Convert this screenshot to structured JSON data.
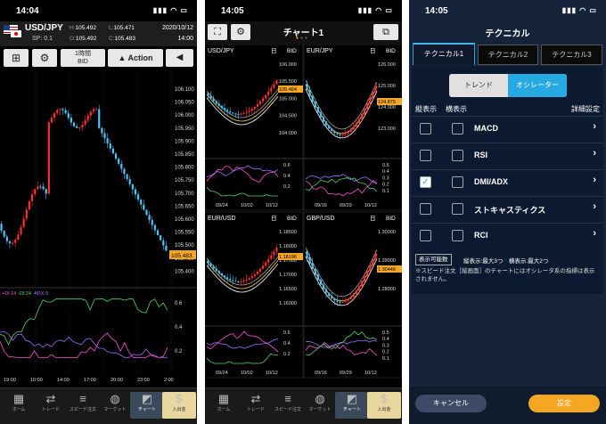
{
  "screen1": {
    "status_time": "14:04",
    "pair": "USD/JPY",
    "spread": "SP: 0.1",
    "high_label": "H:",
    "high_value": "105.492",
    "low_label": "L:",
    "low_value": "105.471",
    "open_label": "O:",
    "open_value": "105.492",
    "close_label": "C:",
    "close_value": "105.483",
    "date": "2020/10/12",
    "time": "14:00",
    "period_line1": "1時間",
    "period_line2": "BID",
    "action_label": "Action",
    "price_labels": [
      "106.100",
      "106.050",
      "106.000",
      "105.950",
      "105.900",
      "105.850",
      "105.800",
      "105.750",
      "105.700",
      "105.650",
      "105.600",
      "105.550",
      "105.500",
      "105.450",
      "105.400"
    ],
    "current_price": "105.483",
    "dmi_legend": {
      "di_plus": "+DI:14",
      "di_minus": "-DI:24",
      "adx": "ADX:9"
    },
    "osc_labels": [
      "0.6",
      "0.4",
      "0.2"
    ],
    "time_labels": [
      "19:00",
      "10:00",
      "14:00",
      "17:00",
      "20:00",
      "23:00",
      "2:00"
    ]
  },
  "screen2": {
    "status_time": "14:05",
    "title": "チャート1",
    "panes": [
      {
        "pair": "USD/JPY",
        "period": "日",
        "type": "BID",
        "prices": [
          "106.000",
          "105.500",
          "105.000",
          "104.500",
          "104.000"
        ],
        "current": "105.484",
        "osc": [
          "0.6",
          "0.4",
          "0.2"
        ],
        "dates": [
          "09/24",
          "10/02",
          "10/12"
        ]
      },
      {
        "pair": "EUR/JPY",
        "period": "日",
        "type": "BID",
        "prices": [
          "126.000",
          "125.000",
          "124.000",
          "123.000"
        ],
        "current": "124.875",
        "osc": [
          "0.5",
          "0.4",
          "0.3",
          "0.2",
          "0.1"
        ],
        "dates": [
          "09/16",
          "09/29",
          "10/12"
        ]
      },
      {
        "pair": "EUR/USD",
        "period": "日",
        "type": "BID",
        "prices": [
          "1.18500",
          "1.18000",
          "1.17500",
          "1.17000",
          "1.16500",
          "1.16000"
        ],
        "current": "1.18196",
        "osc": [
          "0.6",
          "0.4",
          "0.2"
        ],
        "dates": [
          "09/24",
          "10/02",
          "10/12"
        ]
      },
      {
        "pair": "GBP/USD",
        "period": "日",
        "type": "BID",
        "prices": [
          "1.30000",
          "1.29000",
          "1.28000"
        ],
        "current": "1.30446",
        "osc": [
          "0.5",
          "0.4",
          "0.3",
          "0.2",
          "0.1"
        ],
        "dates": [
          "09/16",
          "09/29",
          "10/12"
        ]
      }
    ]
  },
  "screen3": {
    "status_time": "14:05",
    "title": "テクニカル",
    "tabs": [
      "テクニカル1",
      "テクニカル2",
      "テクニカル3"
    ],
    "segments": [
      "トレンド",
      "オシレーター"
    ],
    "col_vertical": "縦表示",
    "col_horizontal": "横表示",
    "col_detail": "詳細設定",
    "items": [
      {
        "name": "MACD",
        "vertical": false,
        "horizontal": false
      },
      {
        "name": "RSI",
        "vertical": false,
        "horizontal": false
      },
      {
        "name": "DMI/ADX",
        "vertical": true,
        "horizontal": false
      },
      {
        "name": "ストキャスティクス",
        "vertical": false,
        "horizontal": false
      },
      {
        "name": "RCI",
        "vertical": false,
        "horizontal": false
      }
    ],
    "count_label": "表示可能数",
    "count_text": "縦表示:最大3つ　横表示:最大2つ",
    "note": "※スピード注文［縦画面］のチャートにはオシレータ系の指標は表示されません。",
    "cancel": "キャンセル",
    "ok": "設定"
  },
  "tabbar": [
    "ホーム",
    "トレード",
    "スピード注文",
    "マーケット",
    "チャート",
    "入出金"
  ],
  "colors": {
    "up": "#ff3030",
    "down": "#4fc3f7",
    "navy": "#1c2c44",
    "accent": "#f5a623",
    "teal": "#27a9e1"
  }
}
